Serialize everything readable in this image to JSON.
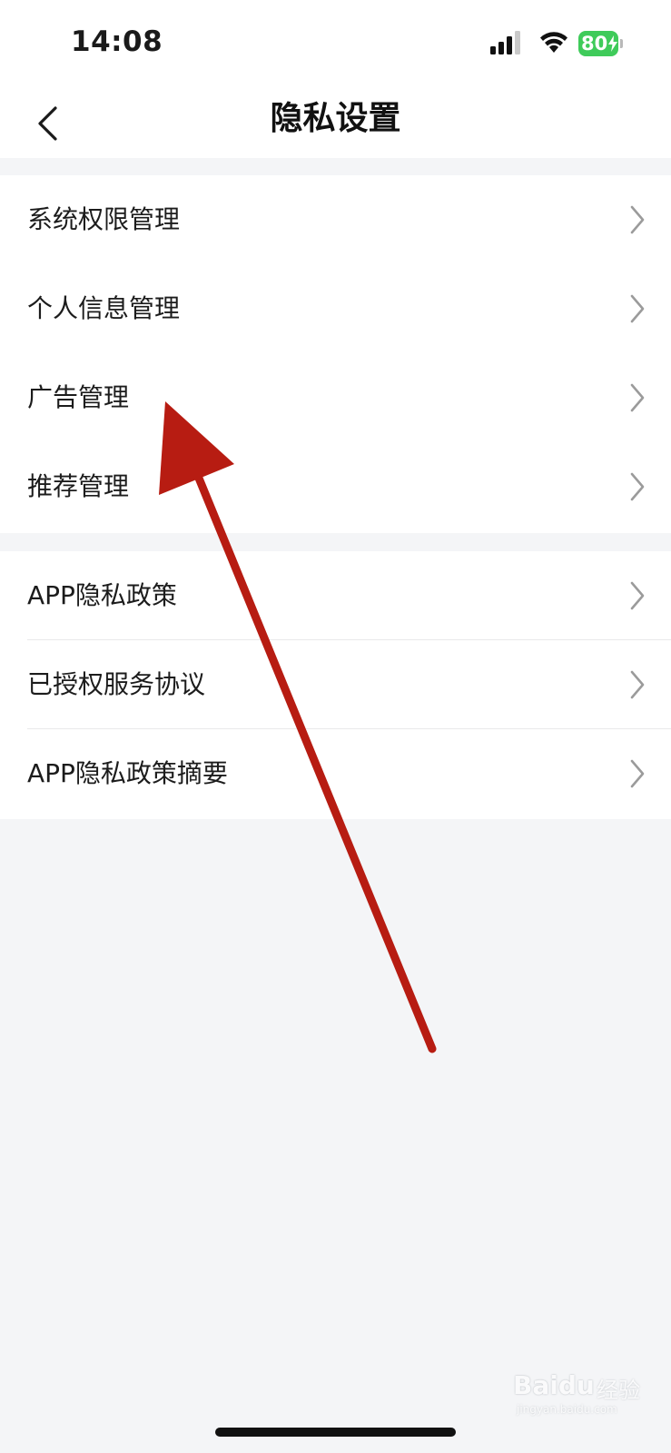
{
  "status_bar": {
    "time": "14:08",
    "battery_level": "80",
    "battery_color": "#3fcb5a"
  },
  "nav": {
    "back_icon": "chevron-left-icon",
    "title": "隐私设置"
  },
  "groups": [
    {
      "items": [
        {
          "label": "系统权限管理"
        },
        {
          "label": "个人信息管理"
        },
        {
          "label": "广告管理"
        },
        {
          "label": "推荐管理"
        }
      ]
    },
    {
      "items": [
        {
          "label": "APP隐私政策"
        },
        {
          "label": "已授权服务协议"
        },
        {
          "label": "APP隐私政策摘要"
        }
      ]
    }
  ],
  "annotation": {
    "type": "arrow",
    "color": "#b71c12",
    "points_to": "广告管理"
  },
  "watermark": {
    "logo": "Baidu",
    "brand": "经验",
    "url": "jingyan.baidu.com"
  }
}
